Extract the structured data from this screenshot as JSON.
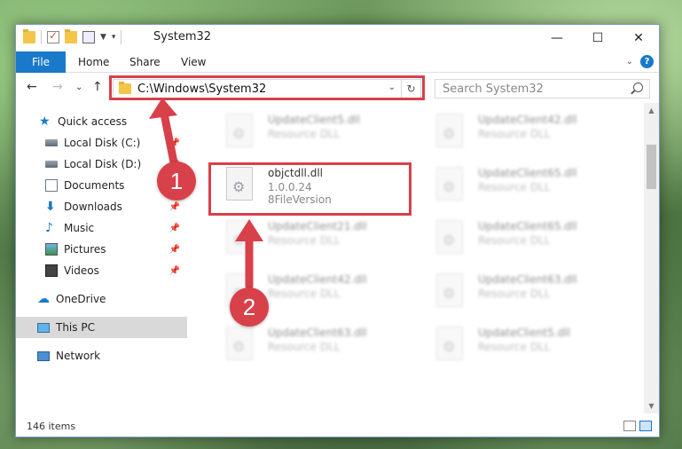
{
  "window": {
    "title": "System32",
    "controls": {
      "minimize": "—",
      "maximize": "☐",
      "close": "✕"
    }
  },
  "ribbon": {
    "tabs": [
      "File",
      "Home",
      "Share",
      "View"
    ]
  },
  "navigation": {
    "address": "C:\\Windows\\System32",
    "search_placeholder": "Search System32"
  },
  "sidebar": {
    "items": [
      {
        "label": "Quick access",
        "icon": "star-icon",
        "pinned": false
      },
      {
        "label": "Local Disk (C:)",
        "icon": "disk-icon",
        "pinned": true
      },
      {
        "label": "Local Disk (D:)",
        "icon": "disk-icon",
        "pinned": true
      },
      {
        "label": "Documents",
        "icon": "document-icon",
        "pinned": true
      },
      {
        "label": "Downloads",
        "icon": "download-icon",
        "pinned": true
      },
      {
        "label": "Music",
        "icon": "music-icon",
        "pinned": true
      },
      {
        "label": "Pictures",
        "icon": "pictures-icon",
        "pinned": true
      },
      {
        "label": "Videos",
        "icon": "video-icon",
        "pinned": true
      },
      {
        "label": "OneDrive",
        "icon": "cloud-icon",
        "pinned": false
      },
      {
        "label": "This PC",
        "icon": "computer-icon",
        "pinned": false,
        "selected": true
      },
      {
        "label": "Network",
        "icon": "network-icon",
        "pinned": false
      }
    ]
  },
  "files": [
    {
      "name": "UpdateClient5.dll",
      "desc": "Resource DLL"
    },
    {
      "name": "UpdateClient42.dll",
      "desc": "Resource DLL"
    },
    {
      "name": "objctdll.dll",
      "desc": "1.0.0.24",
      "desc2": "8FileVersion",
      "highlighted": true
    },
    {
      "name": "UpdateClient65.dll",
      "desc": "Resource DLL"
    },
    {
      "name": "UpdateClient21.dll",
      "desc": "Resource DLL"
    },
    {
      "name": "UpdateClient65.dll",
      "desc": "Resource DLL"
    },
    {
      "name": "UpdateClient42.dll",
      "desc": "Resource DLL"
    },
    {
      "name": "UpdateClient63.dll",
      "desc": "Resource DLL"
    },
    {
      "name": "UpdateClient63.dll",
      "desc": "Resource DLL"
    },
    {
      "name": "UpdateClient5.dll",
      "desc": "Resource DLL"
    }
  ],
  "status": {
    "item_count": "146 items"
  },
  "annotations": {
    "step1": "1",
    "step2": "2",
    "color": "#d8404a"
  },
  "colors": {
    "accent": "#1979ca",
    "highlight": "#d8404a"
  }
}
